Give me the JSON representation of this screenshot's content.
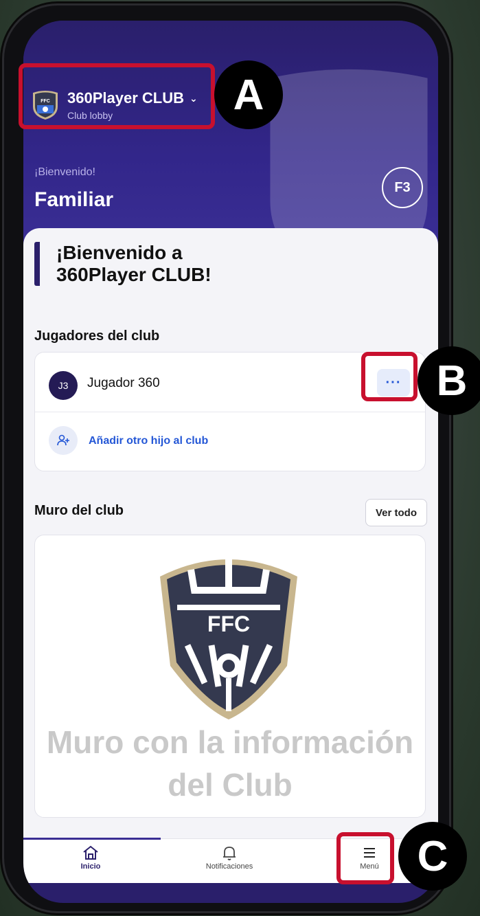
{
  "club": {
    "name": "360Player CLUB",
    "subtitle": "Club lobby",
    "logo_text": "FFC"
  },
  "header": {
    "welcome_small": "¡Bienvenido!",
    "user_name": "Familiar",
    "avatar_initials": "F3"
  },
  "hero": {
    "title": "¡Bienvenido a 360Player CLUB!"
  },
  "players": {
    "section_title": "Jugadores del club",
    "items": [
      {
        "initials": "J3",
        "name": "Jugador 360",
        "more_label": "···"
      }
    ],
    "add_label": "Añadir otro hijo al club"
  },
  "wall": {
    "section_title": "Muro del club",
    "see_all_label": "Ver todo",
    "crest_text": "FFC",
    "placeholder_text": "Muro con la información del Club"
  },
  "nav": {
    "items": [
      {
        "label": "Inicio",
        "icon": "home-icon",
        "active": true
      },
      {
        "label": "Notificaciones",
        "icon": "bell-icon",
        "active": false
      },
      {
        "label": "Menú",
        "icon": "hamburger-icon",
        "active": false
      }
    ]
  },
  "annotations": {
    "a": "A",
    "b": "B",
    "c": "C"
  },
  "colors": {
    "brand_purple": "#2a1f6b",
    "link_blue": "#2457d6",
    "marker_red": "#c8102e",
    "crest_navy": "#34394f",
    "crest_gold": "#c8b68e"
  }
}
